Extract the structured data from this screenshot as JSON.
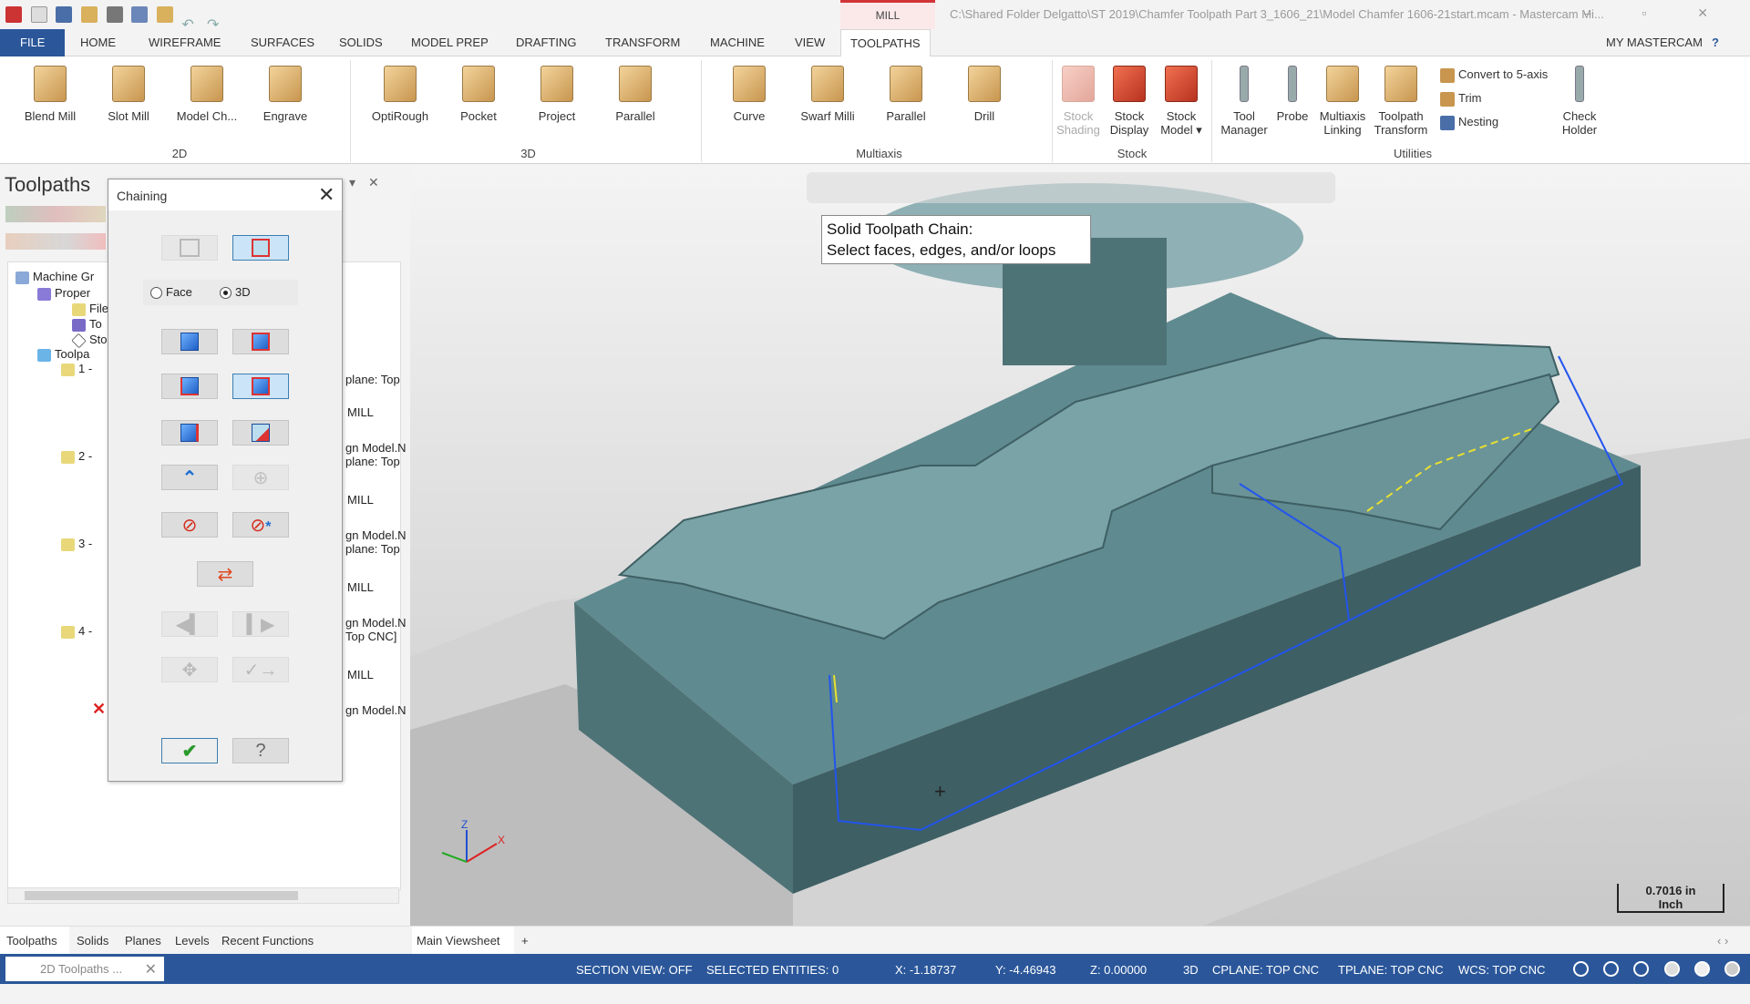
{
  "titlebar": {
    "context_tab": "MILL",
    "window_title": "C:\\Shared Folder Delgatto\\ST 2019\\Chamfer Toolpath Part 3_1606_21\\Model Chamfer 1606-21start.mcam - Mastercam Mi...",
    "controls": "– ▫ ✕"
  },
  "tabs": [
    "FILE",
    "HOME",
    "WIREFRAME",
    "SURFACES",
    "SOLIDS",
    "MODEL PREP",
    "DRAFTING",
    "TRANSFORM",
    "MACHINE",
    "VIEW",
    "TOOLPATHS"
  ],
  "active_tab": "TOOLPATHS",
  "my_mastercam": "MY MASTERCAM",
  "ribbon": {
    "groups": [
      {
        "label": "2D",
        "buttons": [
          "Blend Mill",
          "Slot Mill",
          "Model Ch...",
          "Engrave"
        ]
      },
      {
        "label": "3D",
        "buttons": [
          "OptiRough",
          "Pocket",
          "Project",
          "Parallel"
        ]
      },
      {
        "label": "Multiaxis",
        "buttons": [
          "Curve",
          "Swarf Milli",
          "Parallel",
          "Drill"
        ]
      },
      {
        "label": "Stock",
        "buttons": [
          [
            "Stock",
            "Shading"
          ],
          [
            "Stock",
            "Display"
          ],
          [
            "Stock",
            "Model ▾"
          ]
        ]
      },
      {
        "label": "Utilities",
        "buttons": [
          [
            "Tool",
            "Manager"
          ],
          [
            "Probe",
            ""
          ],
          [
            "Multiaxis",
            "Linking"
          ],
          [
            "Toolpath",
            "Transform"
          ],
          [
            "Check",
            "Holder"
          ]
        ],
        "small": [
          "Convert to 5-axis",
          "Trim",
          "Nesting"
        ]
      }
    ]
  },
  "toolpaths_panel": {
    "title": "Toolpaths",
    "tree": [
      {
        "label": "Machine Gr"
      },
      {
        "label": "Proper"
      },
      {
        "label": "File"
      },
      {
        "label": "To"
      },
      {
        "label": "Sto"
      },
      {
        "label": "Toolpa"
      },
      {
        "label": "1 -"
      },
      {
        "label": "2 -"
      },
      {
        "label": "3 -"
      },
      {
        "label": "4 -"
      }
    ],
    "right_text": [
      "plane: Top",
      "MILL",
      "gn Model.N",
      "plane: Top",
      "MILL",
      "gn Model.N",
      "plane: Top",
      "MILL",
      "gn Model.N",
      "Top CNC]",
      "MILL",
      "gn Model.N"
    ]
  },
  "chaining": {
    "title": "Chaining",
    "radio_face": "Face",
    "radio_3d": "3D",
    "selected": "3D"
  },
  "viewport": {
    "tooltip_line1": "Solid Toolpath Chain:",
    "tooltip_line2": "Select faces, edges, and/or loops",
    "scale_value": "0.7016 in",
    "scale_unit": "Inch",
    "axis_x": "X",
    "axis_z": "Z",
    "part_color": "#5f8a8f"
  },
  "bottom_tabs": [
    "Toolpaths",
    "Solids",
    "Planes",
    "Levels",
    "Recent Functions"
  ],
  "viewsheet": {
    "tab": "Main Viewsheet",
    "add": "+"
  },
  "status": {
    "task": "2D Toolpaths ...",
    "section_view": "SECTION VIEW: OFF",
    "selected": "SELECTED ENTITIES: 0",
    "x": "X:   -1.18737",
    "y": "Y:   -4.46943",
    "z": "Z:   0.00000",
    "mode": "3D",
    "cplane": "CPLANE: TOP CNC",
    "tplane": "TPLANE: TOP CNC",
    "wcs": "WCS: TOP CNC"
  },
  "colors": {
    "accent": "#2b579a",
    "context": "#d13438"
  }
}
